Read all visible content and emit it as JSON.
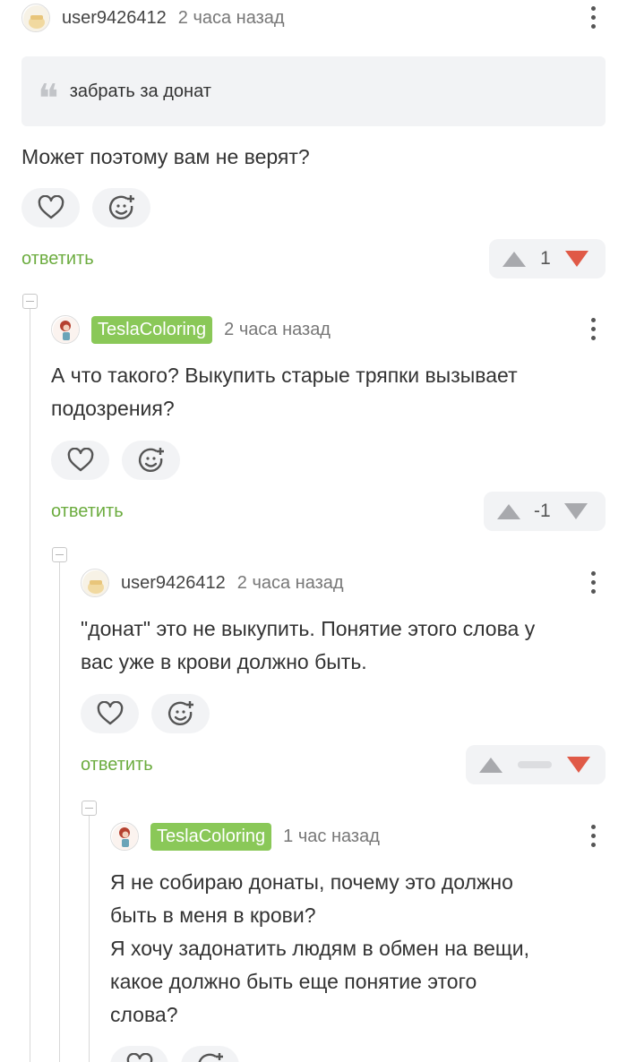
{
  "comments": [
    {
      "username": "user9426412",
      "time": "2 часа назад",
      "quote": "забрать за донат",
      "text": "Может поэтому вам не верят?",
      "reply": "ответить",
      "rating": "1",
      "down_color": "#e05a47"
    },
    {
      "username": "TeslaColoring",
      "time": "2 часа назад",
      "text_lines": [
        "А что такого? Выкупить старые тряпки вызывает",
        "подозрения?"
      ],
      "reply": "ответить",
      "rating": "-1",
      "down_color": "#a8a9ad"
    },
    {
      "username": "user9426412",
      "time": "2 часа назад",
      "text_lines": [
        "\"донат\" это не выкупить. Понятие этого слова у",
        "вас уже в крови должно быть."
      ],
      "reply": "ответить",
      "rating": "",
      "down_color": "#e05a47"
    },
    {
      "username": "TeslaColoring",
      "time": "1 час назад",
      "text_lines": [
        "Я не собираю донаты, почему это должно",
        "быть в меня в крови?",
        "Я хочу задонатить людям в обмен на вещи,",
        "какое должно быть еще понятие этого",
        "слова?"
      ]
    }
  ],
  "icons": {
    "heart": "heart-outline-icon",
    "smiley": "add-reaction-icon",
    "upvote": "arrow-up-icon",
    "downvote": "arrow-down-icon",
    "more": "more-vertical-icon",
    "collapse": "collapse-thread-icon",
    "quote": "quote-icon"
  },
  "colors": {
    "accent_green": "#6cac3f",
    "badge_green": "#8ac858",
    "downvote_red": "#e05a47"
  }
}
